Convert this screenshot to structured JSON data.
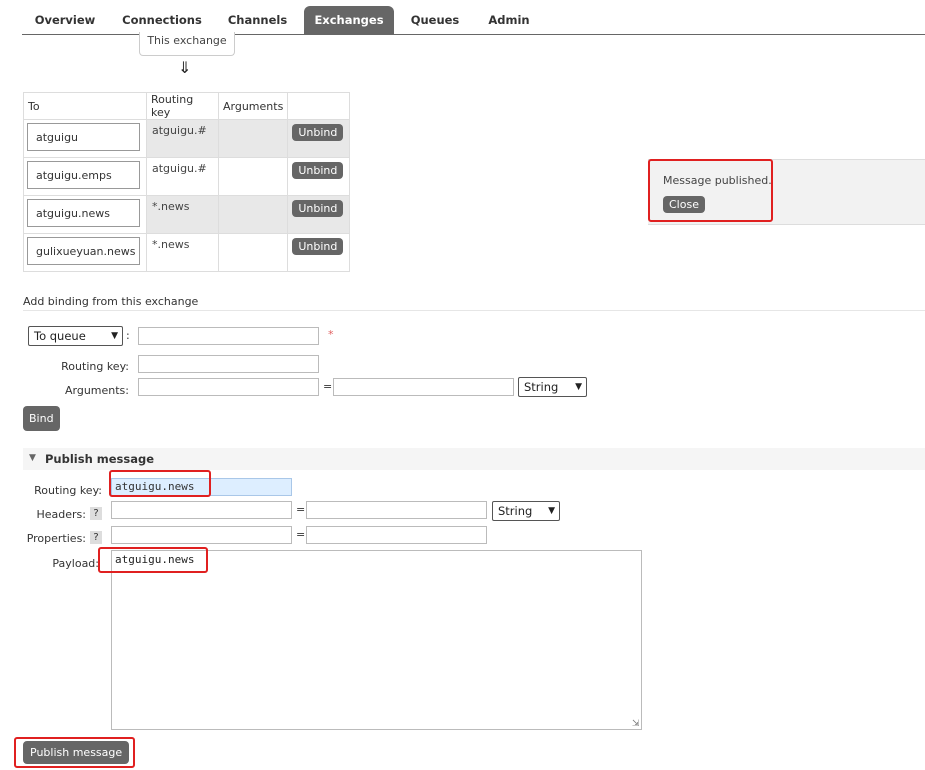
{
  "nav": {
    "tabs": [
      {
        "label": "Overview"
      },
      {
        "label": "Connections"
      },
      {
        "label": "Channels"
      },
      {
        "label": "Exchanges",
        "active": true
      },
      {
        "label": "Queues"
      },
      {
        "label": "Admin"
      }
    ]
  },
  "exchange_box": {
    "label": "This exchange",
    "arrow": "⇓"
  },
  "bindings": {
    "headers": [
      "To",
      "Routing key",
      "Arguments",
      ""
    ],
    "rows": [
      {
        "to": "atguigu",
        "routing_key": "atguigu.#",
        "arguments": "",
        "action": "Unbind"
      },
      {
        "to": "atguigu.emps",
        "routing_key": "atguigu.#",
        "arguments": "",
        "action": "Unbind"
      },
      {
        "to": "atguigu.news",
        "routing_key": "*.news",
        "arguments": "",
        "action": "Unbind"
      },
      {
        "to": "gulixueyuan.news",
        "routing_key": "*.news",
        "arguments": "",
        "action": "Unbind"
      }
    ]
  },
  "notification": {
    "text": "Message published.",
    "close_label": "Close"
  },
  "add_binding": {
    "title": "Add binding from this exchange",
    "destination_type": "To queue",
    "required_mark": "*",
    "routing_key_label": "Routing key:",
    "arguments_label": "Arguments:",
    "equals": "=",
    "type_value": "String",
    "bind_label": "Bind",
    "colon": ":"
  },
  "publish": {
    "title": "Publish message",
    "routing_key_label": "Routing key:",
    "routing_key_value": "atguigu.news",
    "headers_label": "Headers:",
    "properties_label": "Properties:",
    "help": "?",
    "equals": "=",
    "type_value": "String",
    "payload_label": "Payload:",
    "payload_value": "atguigu.news",
    "button_label": "Publish message"
  },
  "colors": {
    "accent": "#666666",
    "highlight": "#e02020",
    "field_focus": "#ddeeff"
  }
}
